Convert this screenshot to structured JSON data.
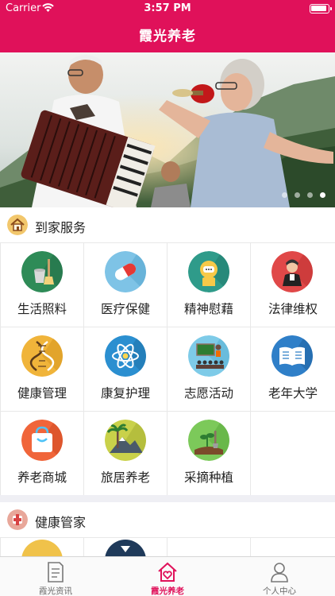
{
  "status_bar": {
    "carrier": "Carrier",
    "time": "3:57 PM"
  },
  "nav": {
    "title": "霞光养老"
  },
  "banner": {
    "page_count": 4,
    "active_page": 4
  },
  "home_service": {
    "title": "到家服务",
    "items": [
      {
        "label": "生活照料",
        "icon": "cleaning-tools-icon"
      },
      {
        "label": "医疗保健",
        "icon": "pill-capsule-icon"
      },
      {
        "label": "精神慰藉",
        "icon": "chat-person-icon"
      },
      {
        "label": "法律维权",
        "icon": "judge-icon"
      },
      {
        "label": "健康管理",
        "icon": "dna-icon"
      },
      {
        "label": "康复护理",
        "icon": "atom-icon"
      },
      {
        "label": "志愿活动",
        "icon": "classroom-icon"
      },
      {
        "label": "老年大学",
        "icon": "open-book-icon"
      },
      {
        "label": "养老商城",
        "icon": "shopping-bag-icon"
      },
      {
        "label": "旅居养老",
        "icon": "palm-mountain-icon"
      },
      {
        "label": "采摘种植",
        "icon": "planting-icon"
      }
    ]
  },
  "health_steward": {
    "title": "健康管家"
  },
  "tabbar": {
    "tabs": [
      {
        "label": "霞光资讯",
        "icon": "news-document-icon",
        "active": false
      },
      {
        "label": "霞光养老",
        "icon": "home-heart-icon",
        "active": true
      },
      {
        "label": "个人中心",
        "icon": "person-icon",
        "active": false
      }
    ]
  },
  "colors": {
    "brand": "#e0115a",
    "tab_inactive": "#666666"
  }
}
